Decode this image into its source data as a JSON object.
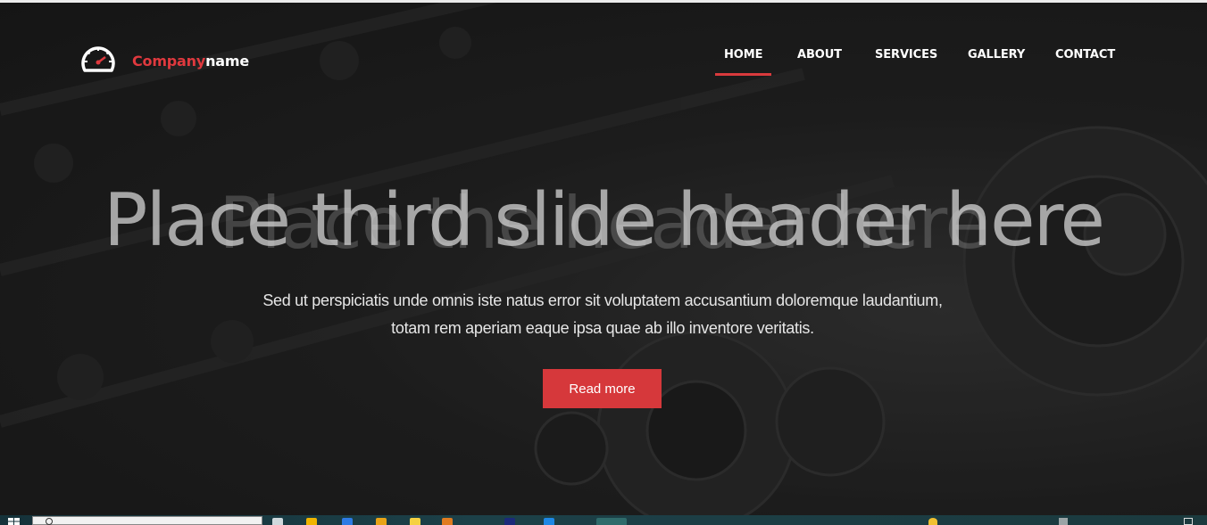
{
  "brand": {
    "part1": "Company",
    "part2": "name"
  },
  "nav": {
    "items": [
      {
        "label": "HOME",
        "active": true
      },
      {
        "label": "ABOUT",
        "active": false
      },
      {
        "label": "SERVICES",
        "active": false
      },
      {
        "label": "GALLERY",
        "active": false
      },
      {
        "label": "CONTACT",
        "active": false
      }
    ]
  },
  "hero": {
    "ghost_title": "Place the header here",
    "title": "Place third slide header here",
    "subtitle_line1": "Sed ut perspiciatis unde omnis iste natus error sit voluptatem accusantium doloremque laudantium,",
    "subtitle_line2": "totam rem aperiam eaque ipsa quae ab illo inventore veritatis.",
    "button_label": "Read more"
  },
  "colors": {
    "accent": "#d6383b",
    "brand_red": "#e0393e",
    "overlay": "#1f1f1f",
    "text": "#ffffff"
  },
  "icons": {
    "logo": "speedometer-icon",
    "start": "windows-start-icon",
    "search": "search-icon"
  }
}
